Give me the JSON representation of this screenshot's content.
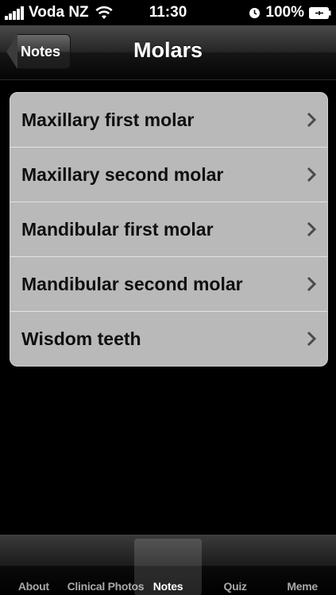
{
  "status_bar": {
    "carrier": "Voda NZ",
    "time": "11:30",
    "battery": "100%"
  },
  "nav": {
    "back_label": "Notes",
    "title": "Molars"
  },
  "list": {
    "items": [
      {
        "label": "Maxillary first molar"
      },
      {
        "label": "Maxillary second molar"
      },
      {
        "label": "Mandibular first molar"
      },
      {
        "label": "Mandibular second molar"
      },
      {
        "label": "Wisdom teeth"
      }
    ]
  },
  "tab_bar": {
    "tabs": [
      {
        "label": "About"
      },
      {
        "label": "Clinical Photos"
      },
      {
        "label": "Notes"
      },
      {
        "label": "Quiz"
      },
      {
        "label": "Meme"
      }
    ],
    "selected": "Notes"
  },
  "icons": {
    "signal": "signal-bars-icon",
    "wifi": "wifi-icon",
    "alarm": "alarm-clock-icon",
    "battery": "battery-charging-icon",
    "chevron": "chevron-right-icon"
  }
}
